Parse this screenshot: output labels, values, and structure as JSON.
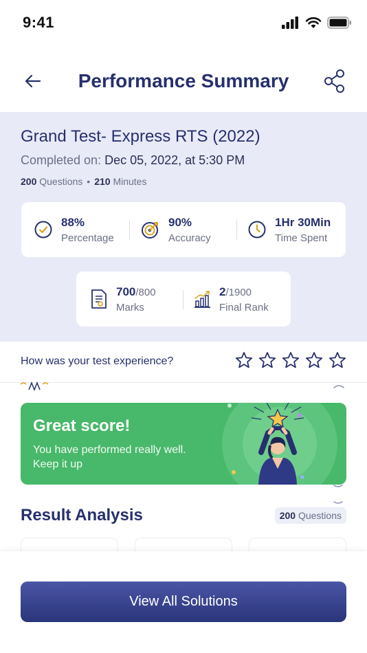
{
  "status_bar": {
    "time": "9:41"
  },
  "header": {
    "title": "Performance Summary"
  },
  "test": {
    "title": "Grand Test- Express RTS (2022)",
    "completed_label": "Completed on: ",
    "completed_value": "Dec 05, 2022, at 5:30 PM",
    "questions_count": "200",
    "questions_label": " Questions",
    "separator": "•",
    "minutes_count": "210",
    "minutes_label": " Minutes"
  },
  "stats": [
    {
      "value": "88%",
      "label": "Percentage",
      "icon": "check-circle-icon"
    },
    {
      "value": "90%",
      "label": "Accuracy",
      "icon": "target-icon"
    },
    {
      "value": "1Hr 30Min",
      "label": "Time Spent",
      "icon": "clock-icon"
    }
  ],
  "marks": {
    "score": "700",
    "total": "/800",
    "label": "Marks",
    "icon": "document-icon"
  },
  "rank": {
    "rank": "2",
    "total": "/1900",
    "label": "Final Rank",
    "icon": "bar-chart-icon"
  },
  "experience": {
    "question": "How was your test experience?",
    "rating_max": 5,
    "rating": 0
  },
  "banner": {
    "title": "Great score!",
    "line1": "You have performed really well.",
    "line2": "Keep it up"
  },
  "result": {
    "title": "Result Analysis",
    "questions_count": "200",
    "questions_label": " Questions"
  },
  "cta": {
    "label": "View All Solutions"
  },
  "colors": {
    "primary": "#26306e",
    "panel_bg": "#e8eaf7",
    "banner_green": "#48b86a",
    "icon_gold": "#d9a521"
  }
}
